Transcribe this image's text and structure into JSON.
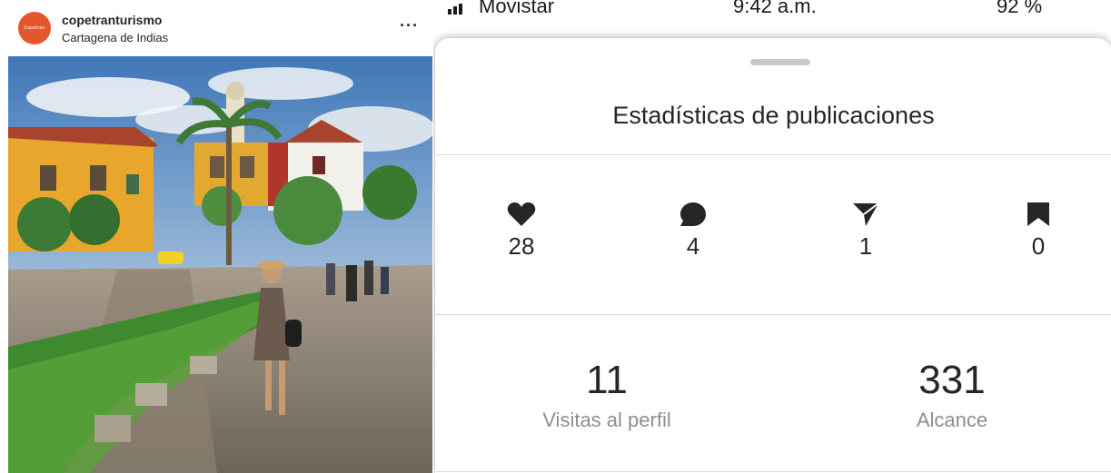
{
  "post": {
    "avatar_text": "Copetran",
    "username": "copetranturismo",
    "location": "Cartagena de Indias",
    "more_icon": "more-horizontal-icon",
    "more_glyph": "···"
  },
  "status_bar": {
    "carrier": "Movistar",
    "time": "9:42 a.m.",
    "battery": "92 %"
  },
  "insights": {
    "title": "Estadísticas de publicaciones",
    "metrics": [
      {
        "icon": "heart-icon",
        "value": "28"
      },
      {
        "icon": "comment-icon",
        "value": "4"
      },
      {
        "icon": "send-icon",
        "value": "1"
      },
      {
        "icon": "bookmark-icon",
        "value": "0"
      }
    ],
    "profile_visits": {
      "value": "11",
      "label": "Visitas al perfil"
    },
    "reach": {
      "value": "331",
      "label": "Alcance"
    }
  }
}
